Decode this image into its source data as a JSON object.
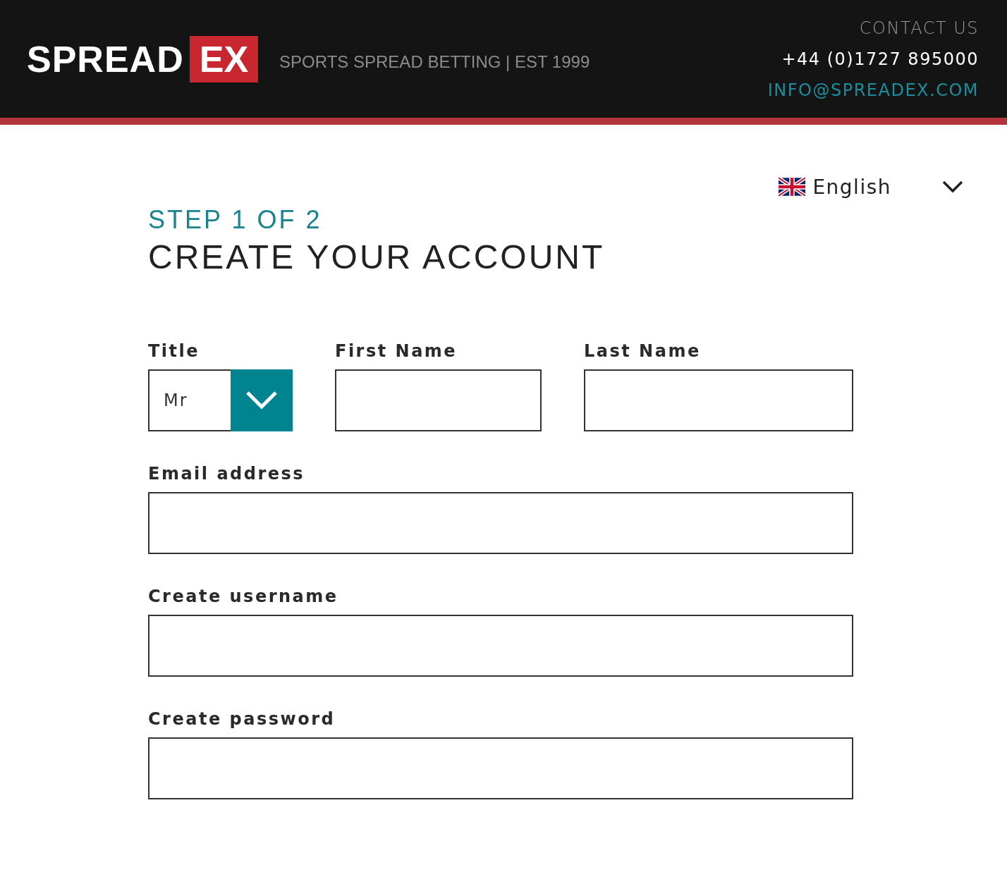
{
  "header": {
    "logo": {
      "word": "SPREAD",
      "badge": "EX"
    },
    "tagline": "SPORTS SPREAD BETTING | EST 1999",
    "contact": {
      "heading": "CONTACT US",
      "phone": "+44 (0)1727 895000",
      "email": "INFO@SPREADEX.COM"
    }
  },
  "language": {
    "label": "English"
  },
  "step": "STEP 1 OF 2",
  "heading": "CREATE YOUR ACCOUNT",
  "rows": [
    [
      {
        "kind": "select",
        "label": "Title",
        "value": "Mr"
      },
      {
        "kind": "text",
        "label": "First Name"
      },
      {
        "kind": "text",
        "label": "Last Name"
      }
    ],
    [
      {
        "kind": "text",
        "label": "Email address"
      }
    ],
    [
      {
        "kind": "text",
        "label": "Create username"
      }
    ],
    [
      {
        "kind": "password",
        "label": "Create password"
      }
    ]
  ]
}
